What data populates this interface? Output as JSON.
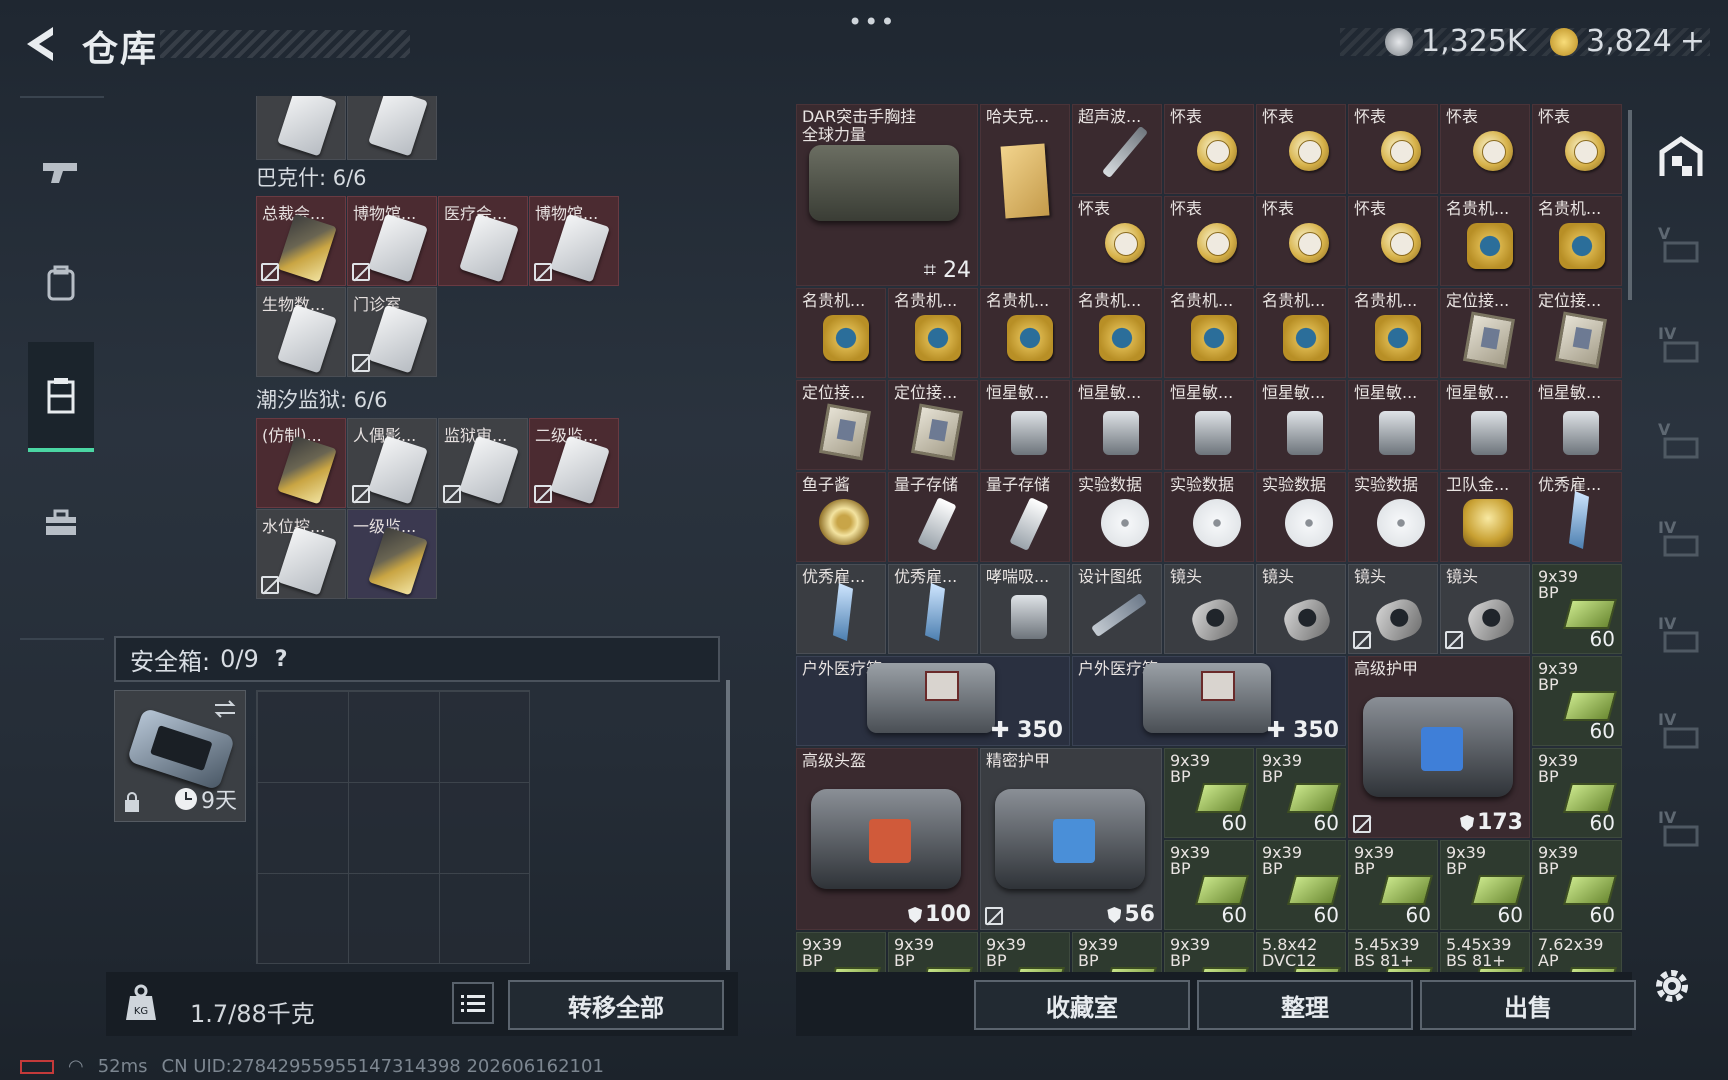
{
  "header": {
    "title": "仓库",
    "menu_dots": "•••"
  },
  "currency": {
    "silver": "1,325K",
    "gold": "3,824",
    "gold_add": "+"
  },
  "stash": {
    "categories": [
      {
        "label": "巴克什: 6/6",
        "items": [
          {
            "name": "总裁会...",
            "card": "gold",
            "banned": true
          },
          {
            "name": "博物馆...",
            "card": "white",
            "banned": true
          },
          {
            "name": "医疗会...",
            "card": "white",
            "banned": false
          },
          {
            "name": "博物馆...",
            "card": "white",
            "banned": true
          },
          {
            "name": "生物数...",
            "card": "white",
            "banned": false
          },
          {
            "name": "门诊室",
            "card": "white",
            "banned": true
          }
        ]
      },
      {
        "label": "潮汐监狱: 6/6",
        "items": [
          {
            "name": "(仿制)...",
            "card": "gold",
            "banned": false
          },
          {
            "name": "人偶影...",
            "card": "white",
            "banned": true
          },
          {
            "name": "监狱审...",
            "card": "white",
            "banned": true
          },
          {
            "name": "二级监...",
            "card": "white",
            "banned": true
          },
          {
            "name": "水位控...",
            "card": "white",
            "banned": true
          },
          {
            "name": "一级监...",
            "card": "white",
            "banned": false
          }
        ]
      }
    ]
  },
  "safe": {
    "label": "安全箱:",
    "count": "0/9",
    "help": "?",
    "days": "9天"
  },
  "bottom_left": {
    "weight": "1.7/88千克",
    "transfer_all": "转移全部"
  },
  "status": {
    "ping": "52ms",
    "uid": "CN UID:2784295595514731439​8 2026061621​01"
  },
  "inventory": {
    "top": {
      "bag": {
        "name": "DAR突击手胸挂",
        "name2": "全球力量",
        "count": "24"
      },
      "book": {
        "name": "哈夫克..."
      },
      "syringe": {
        "name": "超声波..."
      },
      "pocket_watch": "怀表",
      "gold_watch": "名贵机...",
      "locator": "定位接...",
      "stellar": "恒星敏...",
      "fishbait": "鱼子酱",
      "quantum": "量子存储",
      "data": "实验数据",
      "guard": "卫队金...",
      "excellent": "优秀雇...",
      "inhaler": "哮喘吸...",
      "design": "设计图纸",
      "lens": "镜头",
      "ammo_name": "9x39",
      "ammo_sub": "BP",
      "ammo_count": "60",
      "medkit": {
        "name": "户外医疗箱",
        "value": "350"
      },
      "armor": {
        "name": "高级护甲",
        "value": "173"
      },
      "helmet": {
        "name": "高级头盔",
        "value": "100"
      },
      "precision": {
        "name": "精密护甲",
        "value": "56"
      },
      "bottom_row": [
        "9x39",
        "9x39",
        "9x39",
        "9x39",
        "9x39",
        "5.8x42",
        "5.45x39",
        "5.45x39",
        "7.62x39"
      ],
      "bottom_sub": [
        "BP",
        "BP",
        "BP",
        "BP",
        "BP",
        "DVC12",
        "BS 81+",
        "BS 81+",
        "AP"
      ]
    }
  },
  "bottom_right": {
    "collection": "收藏室",
    "organize": "整理",
    "sell": "出售"
  },
  "right_side": {
    "levels": [
      "V",
      "IV",
      "V",
      "IV",
      "IV",
      "IV",
      "IV"
    ]
  }
}
